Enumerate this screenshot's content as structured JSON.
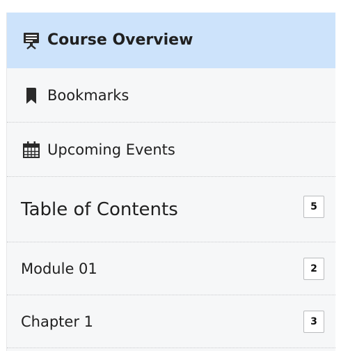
{
  "nav": {
    "items": [
      {
        "label": "Course Overview",
        "icon": "presentation-icon",
        "active": true
      },
      {
        "label": "Bookmarks",
        "icon": "bookmark-icon",
        "active": false
      },
      {
        "label": "Upcoming Events",
        "icon": "calendar-icon",
        "active": false
      },
      {
        "label": "Table of Contents",
        "icon": "",
        "active": false,
        "count": "5"
      },
      {
        "label": "Module 01",
        "icon": "",
        "active": false,
        "count": "2"
      },
      {
        "label": "Chapter 1",
        "icon": "",
        "active": false,
        "count": "3"
      }
    ]
  },
  "colors": {
    "active_background": "#cde3fb",
    "panel_background": "#f6f7f8",
    "icon_color": "#2a2a2a",
    "badge_border": "#b9bbbd"
  }
}
